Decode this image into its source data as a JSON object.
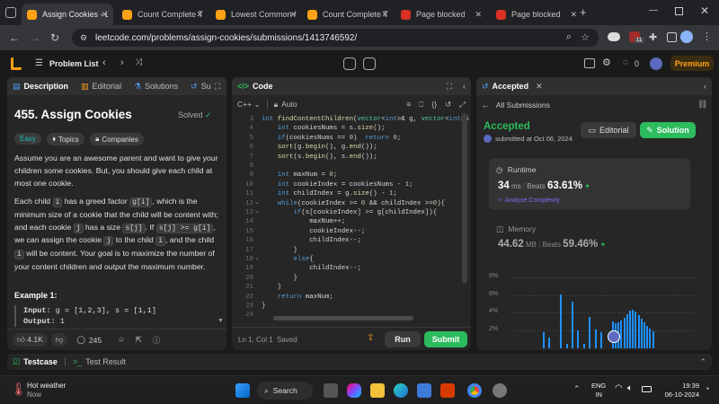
{
  "browser": {
    "tabs": [
      {
        "title": "Assign Cookies - L",
        "active": true,
        "favicon_color": "#ffa116"
      },
      {
        "title": "Count Complete T",
        "active": false,
        "favicon_color": "#ffa116"
      },
      {
        "title": "Lowest Common /",
        "active": false,
        "favicon_color": "#ffa116"
      },
      {
        "title": "Count Complete T",
        "active": false,
        "favicon_color": "#ffa116"
      },
      {
        "title": "Page blocked",
        "active": false,
        "favicon_color": "#d93025"
      },
      {
        "title": "Page blocked",
        "active": false,
        "favicon_color": "#d93025"
      }
    ],
    "url": "leetcode.com/problems/assign-cookies/submissions/1413746592/",
    "ext_badge": "11"
  },
  "lc_top": {
    "problem_list": "Problem List",
    "coins": "0",
    "premium": "Premium"
  },
  "left_panel": {
    "tabs": [
      "Description",
      "Editorial",
      "Solutions",
      "Su"
    ],
    "title": "455. Assign Cookies",
    "status": "Solved",
    "tags": [
      "Easy",
      "Topics",
      "Companies"
    ],
    "para1": "Assume you are an awesome parent and want to give your children some cookies. But, you should give each child at most one cookie.",
    "para2": {
      "t1": "Each child ",
      "c1": "i",
      "t2": " has a greed factor ",
      "c2": "g[i]",
      "t3": ", which is the minimum size of a cookie that the child will be content with; and each cookie ",
      "c3": "j",
      "t4": " has a size ",
      "c4": "s[j]",
      "t5": ". If ",
      "c5": "s[j] >= g[i]",
      "t6": ", we can assign the cookie ",
      "c6": "j",
      "t7": " to the child ",
      "c7": "i",
      "t8": ", and the child ",
      "c8": "i",
      "t9": " will be content. Your goal is to maximize the number of your content children and output the maximum number."
    },
    "example_title": "Example 1:",
    "example_input_label": "Input:",
    "example_input": "g = [1,2,3], s = [1,1]",
    "example_output_label": "Output:",
    "example_output": "1",
    "likes": "4.1K",
    "comments": "245"
  },
  "code_panel": {
    "title": "Code",
    "language": "C++",
    "autosave": "Auto",
    "lines": [
      {
        "n": "3",
        "t": "int findContentChildren(vector<int>& g, vector<int>& s) {"
      },
      {
        "n": "4",
        "t": "    int cookiesNums = s.size();"
      },
      {
        "n": "5",
        "t": "    if(cookiesNums == 0)  return 0;"
      },
      {
        "n": "6",
        "t": "    sort(g.begin(), g.end());"
      },
      {
        "n": "7",
        "t": "    sort(s.begin(), s.end());"
      },
      {
        "n": "8",
        "t": ""
      },
      {
        "n": "9",
        "t": "    int maxNum = 0;"
      },
      {
        "n": "10",
        "t": "    int cookieIndex = cookiesNums - 1;"
      },
      {
        "n": "11",
        "t": "    int childIndex = g.size() - 1;"
      },
      {
        "n": "12",
        "t": "    while(cookieIndex >= 0 && childIndex >=0){"
      },
      {
        "n": "13",
        "t": "        if(s[cookieIndex] >= g[childIndex]){"
      },
      {
        "n": "14",
        "t": "            maxNum++;"
      },
      {
        "n": "15",
        "t": "            cookieIndex--;"
      },
      {
        "n": "16",
        "t": "            childIndex--;"
      },
      {
        "n": "17",
        "t": "        }"
      },
      {
        "n": "18",
        "t": "        else{"
      },
      {
        "n": "19",
        "t": "            childIndex--;"
      },
      {
        "n": "20",
        "t": "        }"
      },
      {
        "n": "21",
        "t": "    }"
      },
      {
        "n": "22",
        "t": "    return maxNum;"
      },
      {
        "n": "23",
        "t": "}"
      },
      {
        "n": "24",
        "t": ""
      }
    ],
    "cursor": "Ln 1, Col 1",
    "saved": "Saved",
    "run": "Run",
    "submit": "Submit"
  },
  "result_panel": {
    "tab": "Accepted",
    "all_submissions": "All Submissions",
    "status": "Accepted",
    "submitted_at": "submitted at Oct 06, 2024",
    "editorial": "Editorial",
    "solution": "Solution",
    "runtime_label": "Runtime",
    "runtime_value": "34",
    "runtime_unit": "ms",
    "beats_label": "Beats",
    "runtime_beats": "63.61%",
    "analyze": "Analyze Complexity",
    "memory_label": "Memory",
    "memory_value": "44.62",
    "memory_unit": "MB",
    "memory_beats": "59.46%",
    "chart_ticks": [
      "8%",
      "6%",
      "4%",
      "2%"
    ]
  },
  "chart_data": {
    "type": "bar",
    "title": "",
    "ylim": [
      0,
      8
    ],
    "yticks": [
      "8%",
      "6%",
      "4%",
      "2%"
    ],
    "values": [
      1.8,
      0,
      1.2,
      0,
      0,
      0,
      6.1,
      0,
      0.5,
      0,
      5.2,
      0,
      2.0,
      0,
      0.5,
      0,
      3.5,
      0,
      2.1,
      0,
      1.8,
      0,
      0,
      0,
      3.0,
      2.8,
      2.9,
      3.1,
      3.4,
      3.8,
      4.2,
      4.3,
      4.1,
      3.7,
      3.3,
      2.9,
      2.5,
      2.2,
      1.9
    ],
    "color": "#1e90ff"
  },
  "testcase_bar": {
    "testcase": "Testcase",
    "test_result": "Test Result"
  },
  "taskbar": {
    "weather": "Hot weather",
    "weather_sub": "Now",
    "search": "Search",
    "lang": "ENG",
    "lang_sub": "IN",
    "time": "19:39",
    "date": "06-10-2024"
  },
  "colors": {
    "accent_green": "#2cbb5d",
    "leetcode_orange": "#ffa116",
    "premium": "#ffa116",
    "bar_blue": "#1e90ff"
  }
}
